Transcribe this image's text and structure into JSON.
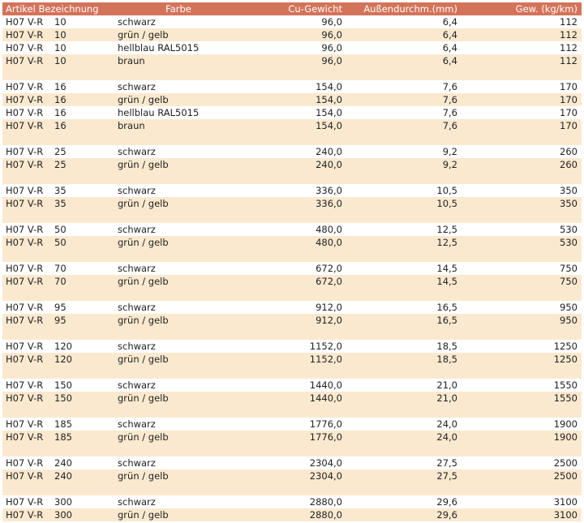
{
  "headers": {
    "article": "Artikel Bezeichnung",
    "color": "Farbe",
    "cu_weight": "Cu-Gewicht",
    "outer_diameter": "Außendurchm.(mm)",
    "weight": "Gew. (kg/km)"
  },
  "groups": [
    {
      "rows": [
        {
          "type": "H07 V-R",
          "size": "10",
          "color": "schwarz",
          "cu": "96,0",
          "diameter": "6,4",
          "weight": "112"
        },
        {
          "type": "H07 V-R",
          "size": "10",
          "color": "grün / gelb",
          "cu": "96,0",
          "diameter": "6,4",
          "weight": "112"
        },
        {
          "type": "H07 V-R",
          "size": "10",
          "color": "hellblau RAL5015",
          "cu": "96,0",
          "diameter": "6,4",
          "weight": "112"
        },
        {
          "type": "H07 V-R",
          "size": "10",
          "color": "braun",
          "cu": "96,0",
          "diameter": "6,4",
          "weight": "112"
        }
      ]
    },
    {
      "rows": [
        {
          "type": "H07 V-R",
          "size": "16",
          "color": "schwarz",
          "cu": "154,0",
          "diameter": "7,6",
          "weight": "170"
        },
        {
          "type": "H07 V-R",
          "size": "16",
          "color": "grün / gelb",
          "cu": "154,0",
          "diameter": "7,6",
          "weight": "170"
        },
        {
          "type": "H07 V-R",
          "size": "16",
          "color": "hellblau RAL5015",
          "cu": "154,0",
          "diameter": "7,6",
          "weight": "170"
        },
        {
          "type": "H07 V-R",
          "size": "16",
          "color": "braun",
          "cu": "154,0",
          "diameter": "7,6",
          "weight": "170"
        }
      ]
    },
    {
      "rows": [
        {
          "type": "H07 V-R",
          "size": "25",
          "color": "schwarz",
          "cu": "240,0",
          "diameter": "9,2",
          "weight": "260"
        },
        {
          "type": "H07 V-R",
          "size": "25",
          "color": "grün / gelb",
          "cu": "240,0",
          "diameter": "9,2",
          "weight": "260"
        }
      ]
    },
    {
      "rows": [
        {
          "type": "H07 V-R",
          "size": "35",
          "color": "schwarz",
          "cu": "336,0",
          "diameter": "10,5",
          "weight": "350"
        },
        {
          "type": "H07 V-R",
          "size": "35",
          "color": "grün / gelb",
          "cu": "336,0",
          "diameter": "10,5",
          "weight": "350"
        }
      ]
    },
    {
      "rows": [
        {
          "type": "H07 V-R",
          "size": "50",
          "color": "schwarz",
          "cu": "480,0",
          "diameter": "12,5",
          "weight": "530"
        },
        {
          "type": "H07 V-R",
          "size": "50",
          "color": "grün / gelb",
          "cu": "480,0",
          "diameter": "12,5",
          "weight": "530"
        }
      ]
    },
    {
      "rows": [
        {
          "type": "H07 V-R",
          "size": "70",
          "color": "schwarz",
          "cu": "672,0",
          "diameter": "14,5",
          "weight": "750"
        },
        {
          "type": "H07 V-R",
          "size": "70",
          "color": "grün / gelb",
          "cu": "672,0",
          "diameter": "14,5",
          "weight": "750"
        }
      ]
    },
    {
      "rows": [
        {
          "type": "H07 V-R",
          "size": "95",
          "color": "schwarz",
          "cu": "912,0",
          "diameter": "16,5",
          "weight": "950"
        },
        {
          "type": "H07 V-R",
          "size": "95",
          "color": "grün / gelb",
          "cu": "912,0",
          "diameter": "16,5",
          "weight": "950"
        }
      ]
    },
    {
      "rows": [
        {
          "type": "H07 V-R",
          "size": "120",
          "color": "schwarz",
          "cu": "1152,0",
          "diameter": "18,5",
          "weight": "1250"
        },
        {
          "type": "H07 V-R",
          "size": "120",
          "color": "grün / gelb",
          "cu": "1152,0",
          "diameter": "18,5",
          "weight": "1250"
        }
      ]
    },
    {
      "rows": [
        {
          "type": "H07 V-R",
          "size": "150",
          "color": "schwarz",
          "cu": "1440,0",
          "diameter": "21,0",
          "weight": "1550"
        },
        {
          "type": "H07 V-R",
          "size": "150",
          "color": "grün / gelb",
          "cu": "1440,0",
          "diameter": "21,0",
          "weight": "1550"
        }
      ]
    },
    {
      "rows": [
        {
          "type": "H07 V-R",
          "size": "185",
          "color": "schwarz",
          "cu": "1776,0",
          "diameter": "24,0",
          "weight": "1900"
        },
        {
          "type": "H07 V-R",
          "size": "185",
          "color": "grün / gelb",
          "cu": "1776,0",
          "diameter": "24,0",
          "weight": "1900"
        }
      ]
    },
    {
      "rows": [
        {
          "type": "H07 V-R",
          "size": "240",
          "color": "schwarz",
          "cu": "2304,0",
          "diameter": "27,5",
          "weight": "2500"
        },
        {
          "type": "H07 V-R",
          "size": "240",
          "color": "grün / gelb",
          "cu": "2304,0",
          "diameter": "27,5",
          "weight": "2500"
        }
      ]
    },
    {
      "rows": [
        {
          "type": "H07 V-R",
          "size": "300",
          "color": "schwarz",
          "cu": "2880,0",
          "diameter": "29,6",
          "weight": "3100"
        },
        {
          "type": "H07 V-R",
          "size": "300",
          "color": "grün / gelb",
          "cu": "2880,0",
          "diameter": "29,6",
          "weight": "3100"
        }
      ]
    }
  ]
}
